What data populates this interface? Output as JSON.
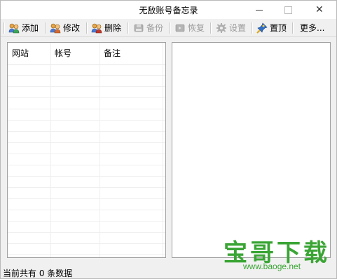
{
  "window": {
    "title": "无敌账号备忘录",
    "close_glyph": "✕"
  },
  "toolbar": {
    "add_label": "添加",
    "edit_label": "修改",
    "delete_label": "删除",
    "backup_label": "备份",
    "restore_label": "恢复",
    "settings_label": "设置",
    "pin_label": "置顶",
    "more_label": "更多..."
  },
  "list": {
    "columns": [
      "网站",
      "帐号",
      "备注"
    ]
  },
  "status": {
    "text": "当前共有 0 条数据"
  },
  "watermark": {
    "brand": "宝哥下载",
    "url": "www.baoge.net"
  },
  "colors": {
    "watermark_green": "#3aa535",
    "disabled_text": "#9a9a9a"
  }
}
